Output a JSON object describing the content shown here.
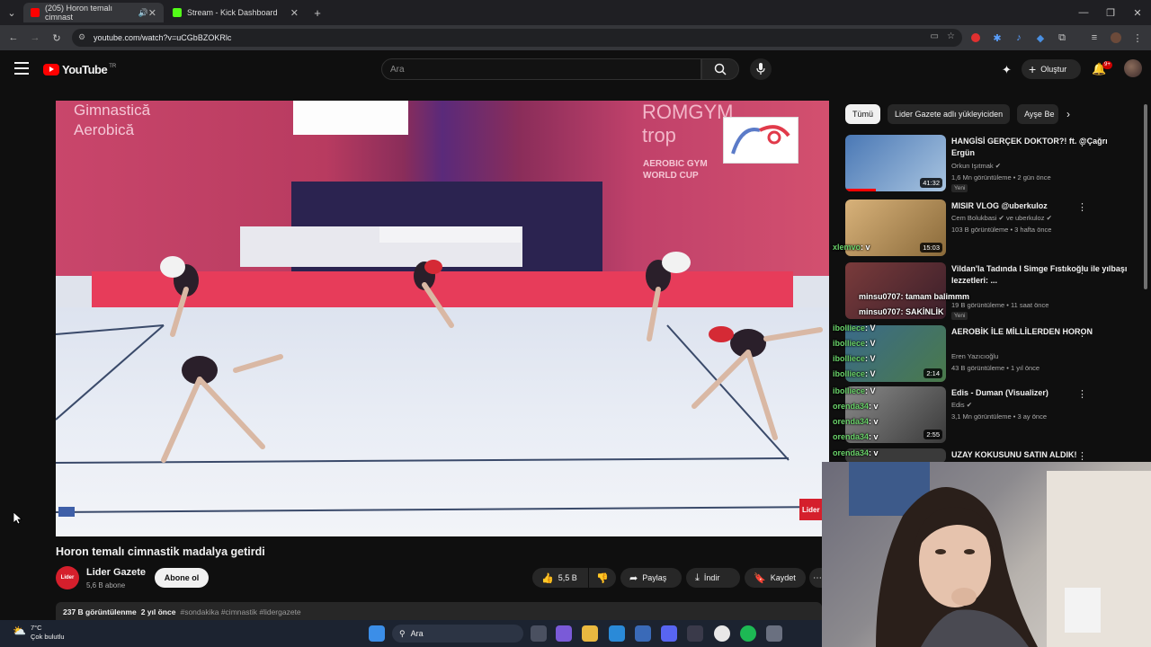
{
  "browser": {
    "tabs": [
      {
        "title": "(205) Horon temalı cimnast",
        "active": true
      },
      {
        "title": "Stream - Kick Dashboard",
        "active": false
      }
    ],
    "url": "youtube.com/watch?v=uCGbBZOKRlc",
    "new_tab": "+"
  },
  "header": {
    "logo_text": "YouTube",
    "region": "TR",
    "search_placeholder": "Ara",
    "create_label": "Oluştur",
    "notification_count": "9+"
  },
  "video": {
    "title": "Horon temalı cimnastik madalya getirdi",
    "overlay_text_1": "Gimnastică Aerobică",
    "overlay_text_2": "ROMGYM trop",
    "overlay_text_3": "AEROBIC GYM WORLD CUP",
    "watermark": "Lider"
  },
  "channel": {
    "avatar_text": "Lider",
    "name": "Lider Gazete",
    "subscribers": "5,6 B abone",
    "subscribe_label": "Abone ol"
  },
  "actions": {
    "likes": "5,5 B",
    "share": "Paylaş",
    "download": "İndir",
    "save": "Kaydet"
  },
  "description": {
    "views": "237 B görüntülenme",
    "date": "2 yıl önce",
    "tags": "#sondakika #cimnastik #lidergazete"
  },
  "sidebar": {
    "chips": [
      "Tümü",
      "Lider Gazete adlı yükleyiciden",
      "Ayşe Be"
    ],
    "recommendations": [
      {
        "title": "HANGİSİ GERÇEK DOKTOR?! ft. @Çağrı Ergün",
        "channel": "Orkun Işıtmak",
        "meta": "1,6 Mn görüntüleme • 2 gün önce",
        "duration": "41:32",
        "badge": "Yeni",
        "thumb": "#5b8ec7"
      },
      {
        "title": "MISIR VLOG @uberkuloz",
        "channel": "Cem Bolukbasi",
        "channel2": "ve uberkuloz",
        "meta": "103 B görüntüleme • 3 hafta önce",
        "duration": "15:03",
        "thumb": "#c9a25d"
      },
      {
        "title": "Vildan'la Tadında l Simge Fıstıkoğlu ile yılbaşı lezzetleri: ...",
        "channel": "",
        "meta": "19 B görüntüleme • 11 saat önce",
        "duration": "",
        "badge": "Yeni",
        "thumb": "#7a3b3b"
      },
      {
        "title": "AEROBİK İLE MİLLİLERDEN HORON",
        "channel": "Eren Yazıcıoğlu",
        "meta": "43 B görüntüleme • 1 yıl önce",
        "duration": "2:14",
        "thumb": "#3f6e4a"
      },
      {
        "title": "Edis - Duman (Visualizer)",
        "channel": "Edis",
        "meta": "3,1 Mn görüntüleme • 3 ay önce",
        "duration": "2:55",
        "thumb": "#6d6d6d"
      },
      {
        "title": "UZAY KOKUSUNU SATIN ALDIK!",
        "channel": "",
        "meta": "",
        "duration": "",
        "thumb": "#333"
      }
    ]
  },
  "chat": [
    {
      "user": "xlemvo",
      "text": ": v"
    },
    {
      "user": "minsu0707",
      "text": ": tamam balimmm"
    },
    {
      "user": "minsu0707",
      "text": ": SAKİNLİK"
    },
    {
      "user": "ibolliece",
      "text": ": V"
    },
    {
      "user": "ibolliece",
      "text": ": V"
    },
    {
      "user": "ibolliece",
      "text": ": V"
    },
    {
      "user": "ibolliece",
      "text": ": V"
    },
    {
      "user": "ibolliece",
      "text": ": V"
    },
    {
      "user": "orenda34",
      "text": ": v"
    },
    {
      "user": "orenda34",
      "text": ": v"
    },
    {
      "user": "orenda34",
      "text": ": v"
    },
    {
      "user": "orenda34",
      "text": ": v"
    }
  ],
  "taskbar": {
    "weather_temp": "7°C",
    "weather_desc": "Çok bulutlu",
    "search_label": "Ara"
  }
}
